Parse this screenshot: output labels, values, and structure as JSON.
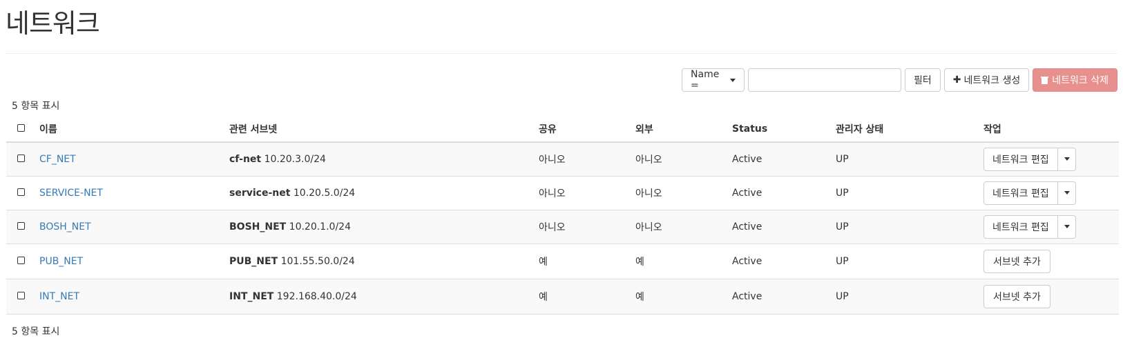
{
  "page": {
    "title": "네트워크"
  },
  "toolbar": {
    "filter_field": "Name =",
    "filter_value": "",
    "filter_button": "필터",
    "create_button": "네트워크 생성",
    "delete_button": "네트워크 삭제"
  },
  "count_text": "5 항목 표시",
  "table": {
    "headers": {
      "name": "이름",
      "subnets": "관련 서브넷",
      "shared": "공유",
      "external": "외부",
      "status": "Status",
      "admin_state": "관리자 상태",
      "actions": "작업"
    },
    "rows": [
      {
        "name": "CF_NET",
        "subnet_name": "cf-net",
        "subnet_cidr": "10.20.3.0/24",
        "shared": "아니오",
        "external": "아니오",
        "status": "Active",
        "admin_state": "UP",
        "action": "네트워크 편집"
      },
      {
        "name": "SERVICE-NET",
        "subnet_name": "service-net",
        "subnet_cidr": "10.20.5.0/24",
        "shared": "아니오",
        "external": "아니오",
        "status": "Active",
        "admin_state": "UP",
        "action": "네트워크 편집"
      },
      {
        "name": "BOSH_NET",
        "subnet_name": "BOSH_NET",
        "subnet_cidr": "10.20.1.0/24",
        "shared": "아니오",
        "external": "아니오",
        "status": "Active",
        "admin_state": "UP",
        "action": "네트워크 편집"
      },
      {
        "name": "PUB_NET",
        "subnet_name": "PUB_NET",
        "subnet_cidr": "101.55.50.0/24",
        "shared": "예",
        "external": "예",
        "status": "Active",
        "admin_state": "UP",
        "action": "서브넷 추가"
      },
      {
        "name": "INT_NET",
        "subnet_name": "INT_NET",
        "subnet_cidr": "192.168.40.0/24",
        "shared": "예",
        "external": "예",
        "status": "Active",
        "admin_state": "UP",
        "action": "서브넷 추가"
      }
    ]
  },
  "colors": {
    "link": "#337ab7",
    "danger_button": "#e8908e",
    "row_stripe": "#f9f9f9"
  }
}
